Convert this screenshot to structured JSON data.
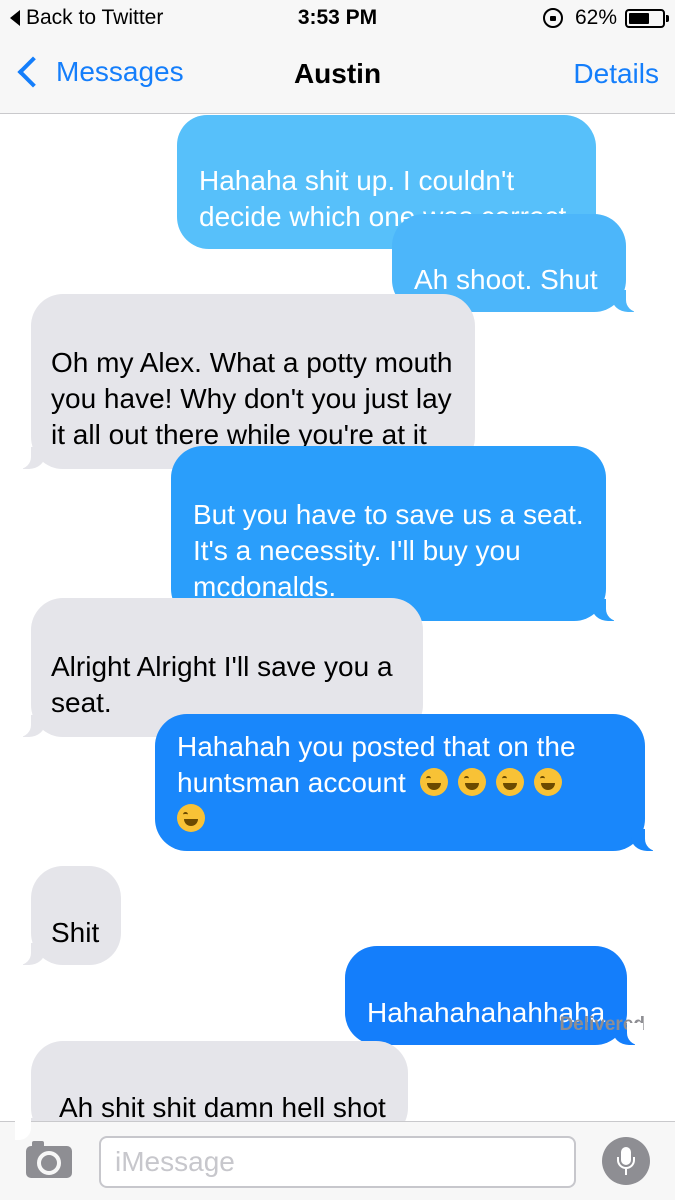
{
  "status_bar": {
    "back_label": "Back to Twitter",
    "time": "3:53 PM",
    "battery_text": "62%",
    "battery_level": 0.62
  },
  "nav": {
    "back_label": "Messages",
    "title": "Austin",
    "details_label": "Details"
  },
  "messages": [
    {
      "direction": "sent",
      "text": "Hahaha shit up. I couldn't\ndecide which one was correct."
    },
    {
      "direction": "sent",
      "text": "Ah shoot. Shut"
    },
    {
      "direction": "received",
      "text": "Oh my Alex. What a potty mouth\nyou have! Why don't you just lay\nit all out there while you're at it"
    },
    {
      "direction": "sent",
      "text": "But you have to save us a seat.\nIt's a necessity. I'll buy you\nmcdonalds."
    },
    {
      "direction": "received",
      "text": "Alright Alright I'll save you a\nseat."
    },
    {
      "direction": "sent",
      "text": "Hahahah you posted that on the\nhuntsman account",
      "emoji": "face-with-tears-of-joy",
      "emoji_count": 5
    },
    {
      "direction": "received",
      "text": "Shit"
    },
    {
      "direction": "sent",
      "text": "Hahahahahahhaha"
    },
    {
      "direction": "received",
      "text": "Ah shit shit damn hell shot"
    }
  ],
  "delivered_label": "Delivered",
  "input": {
    "placeholder": "iMessage",
    "value": ""
  },
  "colors": {
    "sent_bubble_top": "#5ac8fa",
    "sent_bubble_bottom": "#147efb",
    "received_bubble": "#e5e5ea",
    "accent": "#147efb"
  },
  "icons": {
    "camera": "camera-icon",
    "mic": "microphone-icon",
    "back": "chevron-left-icon",
    "lock": "orientation-lock-icon",
    "battery": "battery-icon"
  }
}
